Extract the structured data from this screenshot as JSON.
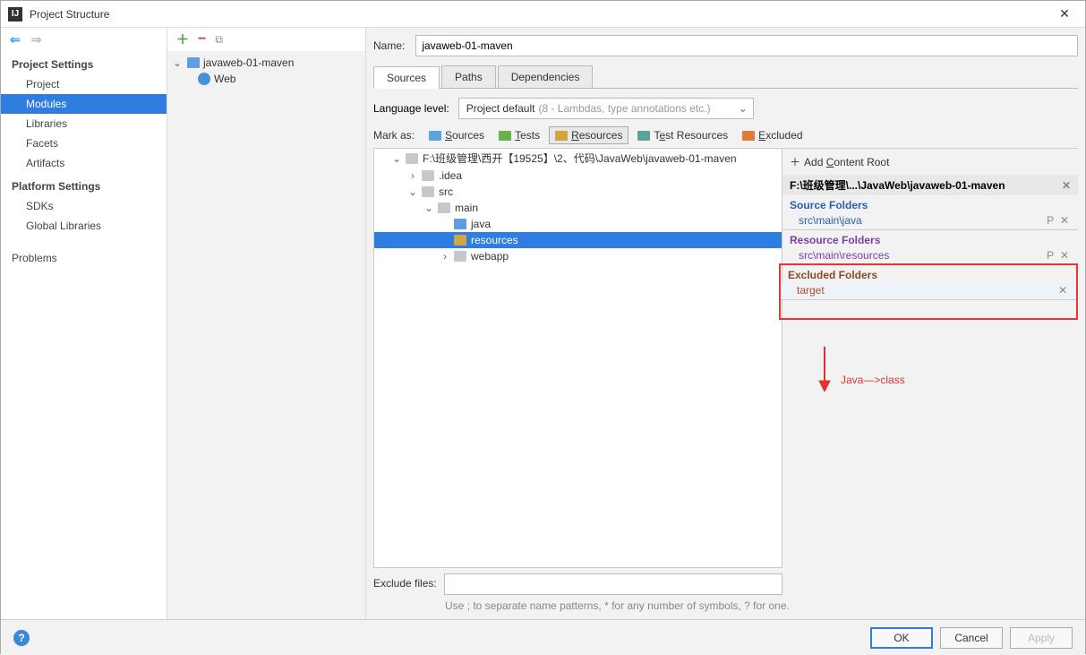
{
  "window": {
    "title": "Project Structure"
  },
  "sidebar": {
    "sections": [
      {
        "title": "Project Settings",
        "items": [
          "Project",
          "Modules",
          "Libraries",
          "Facets",
          "Artifacts"
        ],
        "selected": 1
      },
      {
        "title": "Platform Settings",
        "items": [
          "SDKs",
          "Global Libraries"
        ]
      },
      {
        "title": "",
        "items": [
          "Problems"
        ]
      }
    ]
  },
  "modules_tree": {
    "root": "javaweb-01-maven",
    "children": [
      "Web"
    ]
  },
  "name_field": {
    "label": "Name:",
    "value": "javaweb-01-maven"
  },
  "tabs": [
    "Sources",
    "Paths",
    "Dependencies"
  ],
  "active_tab": 0,
  "language_level": {
    "label": "Language level:",
    "value": "Project default",
    "hint": "(8 - Lambdas, type annotations etc.)"
  },
  "mark_as": {
    "label": "Mark as:",
    "buttons": [
      {
        "name": "Sources",
        "color": "blue",
        "u": "S"
      },
      {
        "name": "Tests",
        "color": "green",
        "u": "T"
      },
      {
        "name": "Resources",
        "color": "gold",
        "u": "R",
        "outlined": true
      },
      {
        "name": "Test Resources",
        "color": "teal",
        "u": ""
      },
      {
        "name": "Excluded",
        "color": "orange",
        "u": "E"
      }
    ]
  },
  "src_tree": {
    "root": "F:\\班级管理\\西开【19525】\\2、代码\\JavaWeb\\javaweb-01-maven",
    "nodes": [
      {
        "label": ".idea",
        "indent": 2,
        "expandable": true,
        "expanded": false
      },
      {
        "label": "src",
        "indent": 2,
        "expandable": true,
        "expanded": true
      },
      {
        "label": "main",
        "indent": 3,
        "expandable": true,
        "expanded": true
      },
      {
        "label": "java",
        "indent": 4,
        "expandable": false,
        "blue": true
      },
      {
        "label": "resources",
        "indent": 4,
        "expandable": false,
        "selected": true,
        "gold": true
      },
      {
        "label": "webapp",
        "indent": 4,
        "expandable": true,
        "expanded": false
      }
    ]
  },
  "content_root": {
    "add_label": "Add Content Root",
    "path": "F:\\班级管理\\...\\JavaWeb\\javaweb-01-maven",
    "groups": [
      {
        "title": "Source Folders",
        "color": "blue",
        "items": [
          "src\\main\\java"
        ]
      },
      {
        "title": "Resource Folders",
        "color": "purple",
        "items": [
          "src\\main\\resources"
        ]
      },
      {
        "title": "Excluded Folders",
        "color": "brown",
        "items": [
          "target"
        ],
        "boxed": true
      }
    ]
  },
  "annotation": "Java—>class",
  "exclude": {
    "label": "Exclude files:",
    "value": "",
    "hint": "Use ; to separate name patterns, * for any number of symbols, ? for one."
  },
  "footer": {
    "ok": "OK",
    "cancel": "Cancel",
    "apply": "Apply"
  }
}
